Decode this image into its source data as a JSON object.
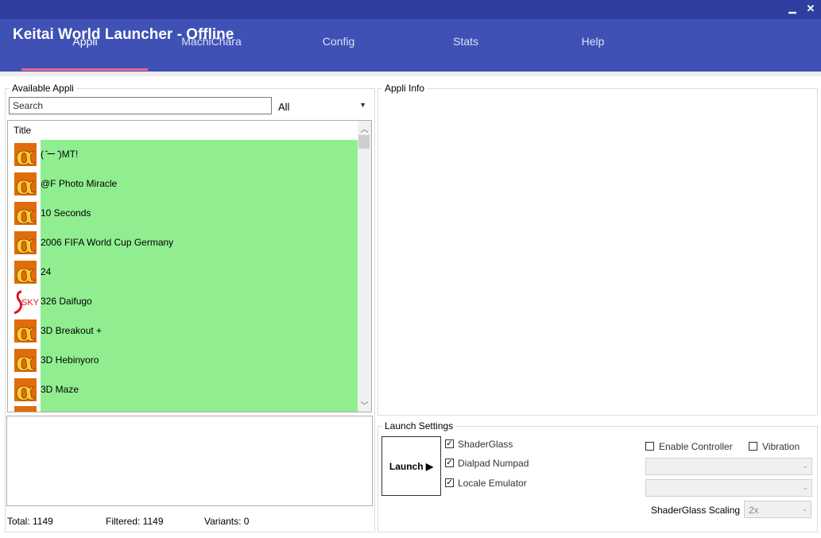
{
  "window": {
    "title": "Keitai World Launcher - Offline",
    "controls": {
      "minimize": "▁",
      "close": "✕"
    }
  },
  "tabs": [
    {
      "label": "Appli",
      "active": true
    },
    {
      "label": "MachiChara"
    },
    {
      "label": "Config"
    },
    {
      "label": "Stats"
    },
    {
      "label": "Help"
    }
  ],
  "colors": {
    "header": "#3f51b5",
    "titlebar": "#303f9f",
    "accent": "#f06292",
    "row_highlight": "#90ee90"
  },
  "available": {
    "label": "Available Appli",
    "search_placeholder": "Search",
    "filter_value": "All",
    "column_title": "Title",
    "items": [
      {
        "title": "( ̄ー ̄)MT!",
        "icon": "alpha-icon"
      },
      {
        "title": "@F Photo Miracle",
        "icon": "alpha-icon"
      },
      {
        "title": "10 Seconds",
        "icon": "alpha-icon"
      },
      {
        "title": "2006 FIFA World Cup Germany",
        "icon": "alpha-icon"
      },
      {
        "title": "24",
        "icon": "alpha-icon"
      },
      {
        "title": "326 Daifugo",
        "icon": "sky-icon"
      },
      {
        "title": "3D Breakout +",
        "icon": "alpha-icon"
      },
      {
        "title": "3D Hebinyoro",
        "icon": "alpha-icon"
      },
      {
        "title": "3D Maze",
        "icon": "alpha-icon"
      }
    ],
    "sky_text": "SKY"
  },
  "stats": {
    "total": "Total: 1149",
    "filtered": "Filtered: 1149",
    "variants": "Variants: 0"
  },
  "info": {
    "label": "Appli Info"
  },
  "launch": {
    "label": "Launch Settings",
    "button": "Launch ▶",
    "options": [
      {
        "label": "ShaderGlass",
        "checked": true
      },
      {
        "label": "Dialpad Numpad",
        "checked": true
      },
      {
        "label": "Locale Emulator",
        "checked": true
      }
    ],
    "enable_controller": "Enable Controller",
    "vibration": "Vibration",
    "scaling_label": "ShaderGlass Scaling",
    "scaling_value": "2x"
  }
}
